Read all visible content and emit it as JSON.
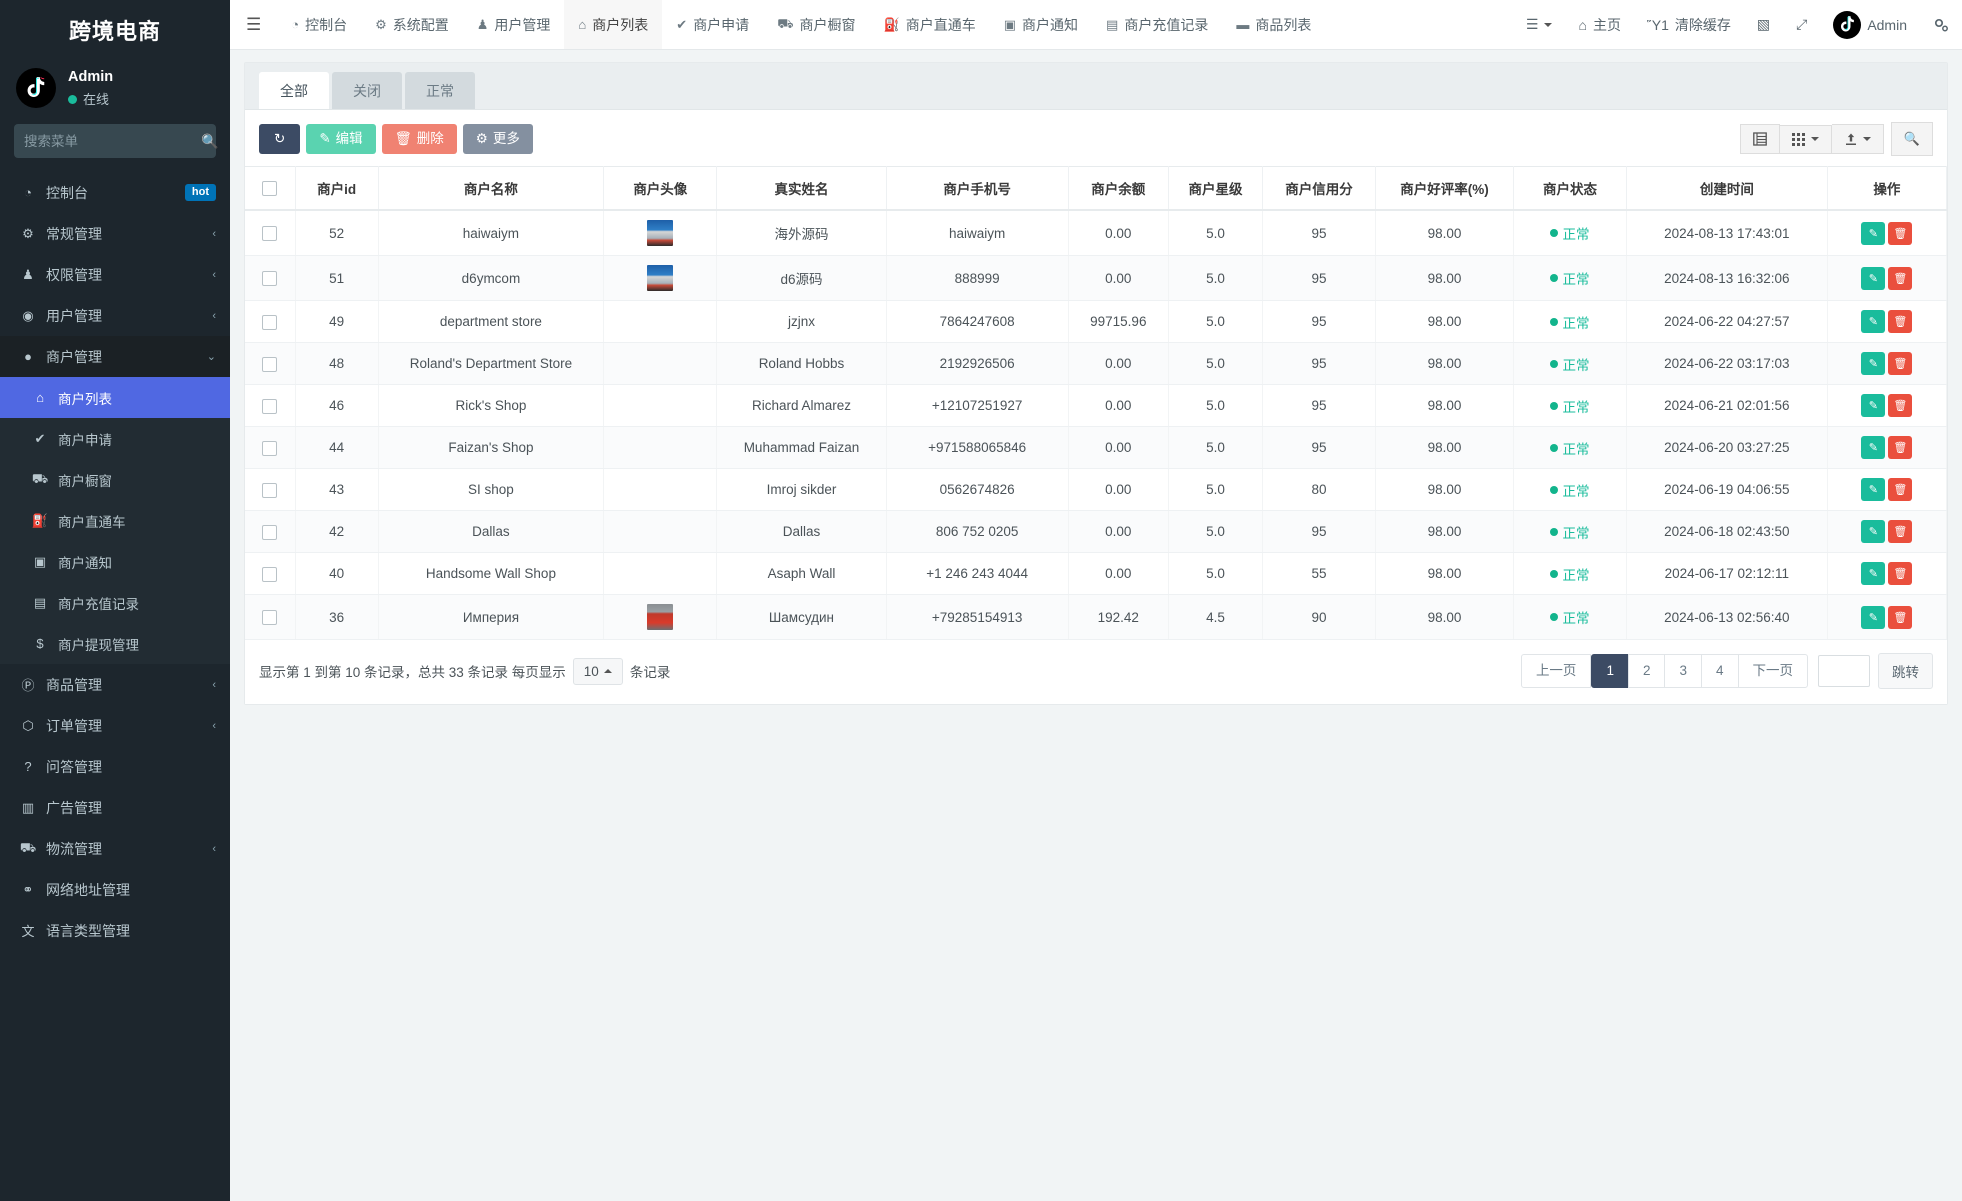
{
  "sidebar": {
    "brand": "跨境电商",
    "user": {
      "name": "Admin",
      "status": "在线",
      "avatar_icon": "tiktok-logo-icon"
    },
    "search": {
      "placeholder": "搜索菜单",
      "value": "",
      "icon": "search-icon"
    },
    "items": [
      {
        "label": "控制台",
        "icon": "dashboard-icon",
        "badge": "hot",
        "arrow": "",
        "level": "top",
        "state": ""
      },
      {
        "label": "常规管理",
        "icon": "gears-icon",
        "badge": "",
        "arrow": "‹",
        "level": "top",
        "state": ""
      },
      {
        "label": "权限管理",
        "icon": "users-icon",
        "badge": "",
        "arrow": "‹",
        "level": "top",
        "state": ""
      },
      {
        "label": "用户管理",
        "icon": "user-circle-icon",
        "badge": "",
        "arrow": "‹",
        "level": "top",
        "state": ""
      },
      {
        "label": "商户管理",
        "icon": "apple-icon",
        "badge": "",
        "arrow": "⌄",
        "level": "top",
        "state": "open"
      },
      {
        "label": "商户列表",
        "icon": "home-icon",
        "badge": "",
        "arrow": "",
        "level": "sub",
        "state": "active"
      },
      {
        "label": "商户申请",
        "icon": "check-circle-icon",
        "badge": "",
        "arrow": "",
        "level": "sub",
        "state": ""
      },
      {
        "label": "商户橱窗",
        "icon": "cart-icon",
        "badge": "",
        "arrow": "",
        "level": "sub",
        "state": ""
      },
      {
        "label": "商户直通车",
        "icon": "car-icon",
        "badge": "",
        "arrow": "",
        "level": "sub",
        "state": ""
      },
      {
        "label": "商户通知",
        "icon": "window-icon",
        "badge": "",
        "arrow": "",
        "level": "sub",
        "state": ""
      },
      {
        "label": "商户充值记录",
        "icon": "money-icon",
        "badge": "",
        "arrow": "",
        "level": "sub",
        "state": ""
      },
      {
        "label": "商户提现管理",
        "icon": "dollar-icon",
        "badge": "",
        "arrow": "",
        "level": "sub",
        "state": ""
      },
      {
        "label": "商品管理",
        "icon": "product-icon",
        "badge": "",
        "arrow": "‹",
        "level": "top",
        "state": ""
      },
      {
        "label": "订单管理",
        "icon": "cube-icon",
        "badge": "",
        "arrow": "‹",
        "level": "top",
        "state": ""
      },
      {
        "label": "问答管理",
        "icon": "question-icon",
        "badge": "",
        "arrow": "",
        "level": "top",
        "state": ""
      },
      {
        "label": "广告管理",
        "icon": "ad-icon",
        "badge": "",
        "arrow": "",
        "level": "top",
        "state": ""
      },
      {
        "label": "物流管理",
        "icon": "truck-icon",
        "badge": "",
        "arrow": "‹",
        "level": "top",
        "state": ""
      },
      {
        "label": "网络地址管理",
        "icon": "link-icon",
        "badge": "",
        "arrow": "",
        "level": "top",
        "state": ""
      },
      {
        "label": "语言类型管理",
        "icon": "language-icon",
        "badge": "",
        "arrow": "",
        "level": "top",
        "state": ""
      }
    ]
  },
  "topbar": {
    "toggle_icon": "hamburger-icon",
    "nav": [
      {
        "label": "控制台",
        "icon": "dashboard-icon",
        "active": false
      },
      {
        "label": "系统配置",
        "icon": "gear-icon",
        "active": false
      },
      {
        "label": "用户管理",
        "icon": "user-icon",
        "active": false
      },
      {
        "label": "商户列表",
        "icon": "home-icon",
        "active": true
      },
      {
        "label": "商户申请",
        "icon": "check-circle-icon",
        "active": false
      },
      {
        "label": "商户橱窗",
        "icon": "cart-icon",
        "active": false
      },
      {
        "label": "商户直通车",
        "icon": "car-icon",
        "active": false
      },
      {
        "label": "商户通知",
        "icon": "window-icon",
        "active": false
      },
      {
        "label": "商户充值记录",
        "icon": "money-icon",
        "active": false
      },
      {
        "label": "商品列表",
        "icon": "briefcase-icon",
        "active": false
      }
    ],
    "right": [
      {
        "label": "",
        "icon": "list-menu-icon",
        "caret": true
      },
      {
        "label": "主页",
        "icon": "home-icon",
        "caret": false
      },
      {
        "label": "清除缓存",
        "icon": "trash-icon",
        "caret": false
      },
      {
        "label": "",
        "icon": "book-icon",
        "caret": false
      },
      {
        "label": "",
        "icon": "fullscreen-icon",
        "caret": false
      }
    ],
    "account": {
      "name": "Admin",
      "avatar_icon": "tiktok-logo-icon"
    },
    "settings_icon": "gears-icon"
  },
  "tabs": [
    {
      "label": "全部",
      "active": true
    },
    {
      "label": "关闭",
      "active": false
    },
    {
      "label": "正常",
      "active": false
    }
  ],
  "toolbar": {
    "refresh_icon": "refresh-icon",
    "edit_label": "编辑",
    "edit_icon": "pencil-icon",
    "delete_label": "删除",
    "delete_icon": "trash-icon",
    "more_label": "更多",
    "more_icon": "gear-icon",
    "right_buttons": [
      {
        "icon": "table-view-icon",
        "caret": false
      },
      {
        "icon": "columns-icon",
        "caret": true
      },
      {
        "icon": "export-icon",
        "caret": true
      },
      {
        "icon": "search-icon",
        "caret": false
      }
    ]
  },
  "table": {
    "columns": [
      "",
      "商户id",
      "商户名称",
      "商户头像",
      "真实姓名",
      "商户手机号",
      "商户余额",
      "商户星级",
      "商户信用分",
      "商户好评率(%)",
      "商户状态",
      "创建时间",
      "操作"
    ],
    "rows": [
      {
        "id": "52",
        "name": "haiwaiym",
        "avatar": "blue",
        "realname": "海外源码",
        "phone": "haiwaiym",
        "balance": "0.00",
        "star": "5.0",
        "credit": "95",
        "praise": "98.00",
        "status": "正常",
        "created": "2024-08-13 17:43:01"
      },
      {
        "id": "51",
        "name": "d6ymcom",
        "avatar": "blue",
        "realname": "d6源码",
        "phone": "888999",
        "balance": "0.00",
        "star": "5.0",
        "credit": "95",
        "praise": "98.00",
        "status": "正常",
        "created": "2024-08-13 16:32:06"
      },
      {
        "id": "49",
        "name": "department store",
        "avatar": "",
        "realname": "jzjnx",
        "phone": "7864247608",
        "balance": "99715.96",
        "star": "5.0",
        "credit": "95",
        "praise": "98.00",
        "status": "正常",
        "created": "2024-06-22 04:27:57"
      },
      {
        "id": "48",
        "name": "Roland's Department Store",
        "avatar": "",
        "realname": "Roland Hobbs",
        "phone": "2192926506",
        "balance": "0.00",
        "star": "5.0",
        "credit": "95",
        "praise": "98.00",
        "status": "正常",
        "created": "2024-06-22 03:17:03"
      },
      {
        "id": "46",
        "name": "Rick's Shop",
        "avatar": "",
        "realname": "Richard Almarez",
        "phone": "+12107251927",
        "balance": "0.00",
        "star": "5.0",
        "credit": "95",
        "praise": "98.00",
        "status": "正常",
        "created": "2024-06-21 02:01:56"
      },
      {
        "id": "44",
        "name": "Faizan's Shop",
        "avatar": "",
        "realname": "Muhammad Faizan",
        "phone": "+971588065846",
        "balance": "0.00",
        "star": "5.0",
        "credit": "95",
        "praise": "98.00",
        "status": "正常",
        "created": "2024-06-20 03:27:25"
      },
      {
        "id": "43",
        "name": "SI shop",
        "avatar": "",
        "realname": "Imroj sikder",
        "phone": "0562674826",
        "balance": "0.00",
        "star": "5.0",
        "credit": "80",
        "praise": "98.00",
        "status": "正常",
        "created": "2024-06-19 04:06:55"
      },
      {
        "id": "42",
        "name": "Dallas",
        "avatar": "",
        "realname": "Dallas",
        "phone": "806 752 0205",
        "balance": "0.00",
        "star": "5.0",
        "credit": "95",
        "praise": "98.00",
        "status": "正常",
        "created": "2024-06-18 02:43:50"
      },
      {
        "id": "40",
        "name": "Handsome Wall Shop",
        "avatar": "",
        "realname": "Asaph Wall",
        "phone": "+1 246 243 4044",
        "balance": "0.00",
        "star": "5.0",
        "credit": "55",
        "praise": "98.00",
        "status": "正常",
        "created": "2024-06-17 02:12:11"
      },
      {
        "id": "36",
        "name": "Империя",
        "avatar": "red",
        "realname": "Шамсудин",
        "phone": "+79285154913",
        "balance": "192.42",
        "star": "4.5",
        "credit": "90",
        "praise": "98.00",
        "status": "正常",
        "created": "2024-06-13 02:56:40"
      }
    ],
    "row_action_edit_icon": "pencil-icon",
    "row_action_delete_icon": "trash-icon"
  },
  "footer": {
    "summary": "显示第 1 到第 10 条记录，总共 33 条记录 每页显示",
    "page_size": "10",
    "summary_suffix": "条记录",
    "pager": {
      "prev": "上一页",
      "pages": [
        "1",
        "2",
        "3",
        "4"
      ],
      "active_page": "1",
      "next": "下一页",
      "jump_value": "",
      "jump_label": "跳转"
    }
  },
  "colors": {
    "sidebar_bg": "#1d262d",
    "active_menu": "#5068e2",
    "accent_teal": "#1abc9c",
    "danger": "#ea4f3d",
    "dark_button": "#3c4b64"
  }
}
